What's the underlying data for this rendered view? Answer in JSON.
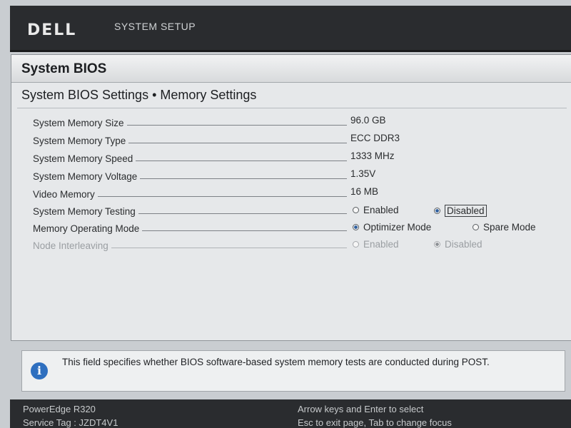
{
  "header": {
    "logo": "DELL",
    "title": "SYSTEM SETUP"
  },
  "panel": {
    "title": "System BIOS",
    "section_title": "System BIOS Settings • Memory Settings"
  },
  "settings": {
    "memory_size": {
      "label": "System Memory Size",
      "value": "96.0 GB"
    },
    "memory_type": {
      "label": "System Memory Type",
      "value": "ECC DDR3"
    },
    "memory_speed": {
      "label": "System Memory Speed",
      "value": "1333 MHz"
    },
    "memory_voltage": {
      "label": "System Memory Voltage",
      "value": "1.35V"
    },
    "video_memory": {
      "label": "Video Memory",
      "value": "16 MB"
    },
    "memory_testing": {
      "label": "System Memory Testing",
      "options": [
        "Enabled",
        "Disabled"
      ],
      "selected": "Disabled"
    },
    "operating_mode": {
      "label": "Memory Operating Mode",
      "options": [
        "Optimizer Mode",
        "Spare Mode"
      ],
      "selected": "Optimizer Mode"
    },
    "node_interleaving": {
      "label": "Node Interleaving",
      "options": [
        "Enabled",
        "Disabled"
      ],
      "selected": "Disabled"
    }
  },
  "info": {
    "text": "This field specifies whether BIOS software-based system memory tests are conducted during POST."
  },
  "status": {
    "model": "PowerEdge R320",
    "service_tag": "Service Tag : JZDT4V1",
    "hint1": "Arrow keys and Enter to select",
    "hint2": "Esc to exit page, Tab to change focus"
  }
}
